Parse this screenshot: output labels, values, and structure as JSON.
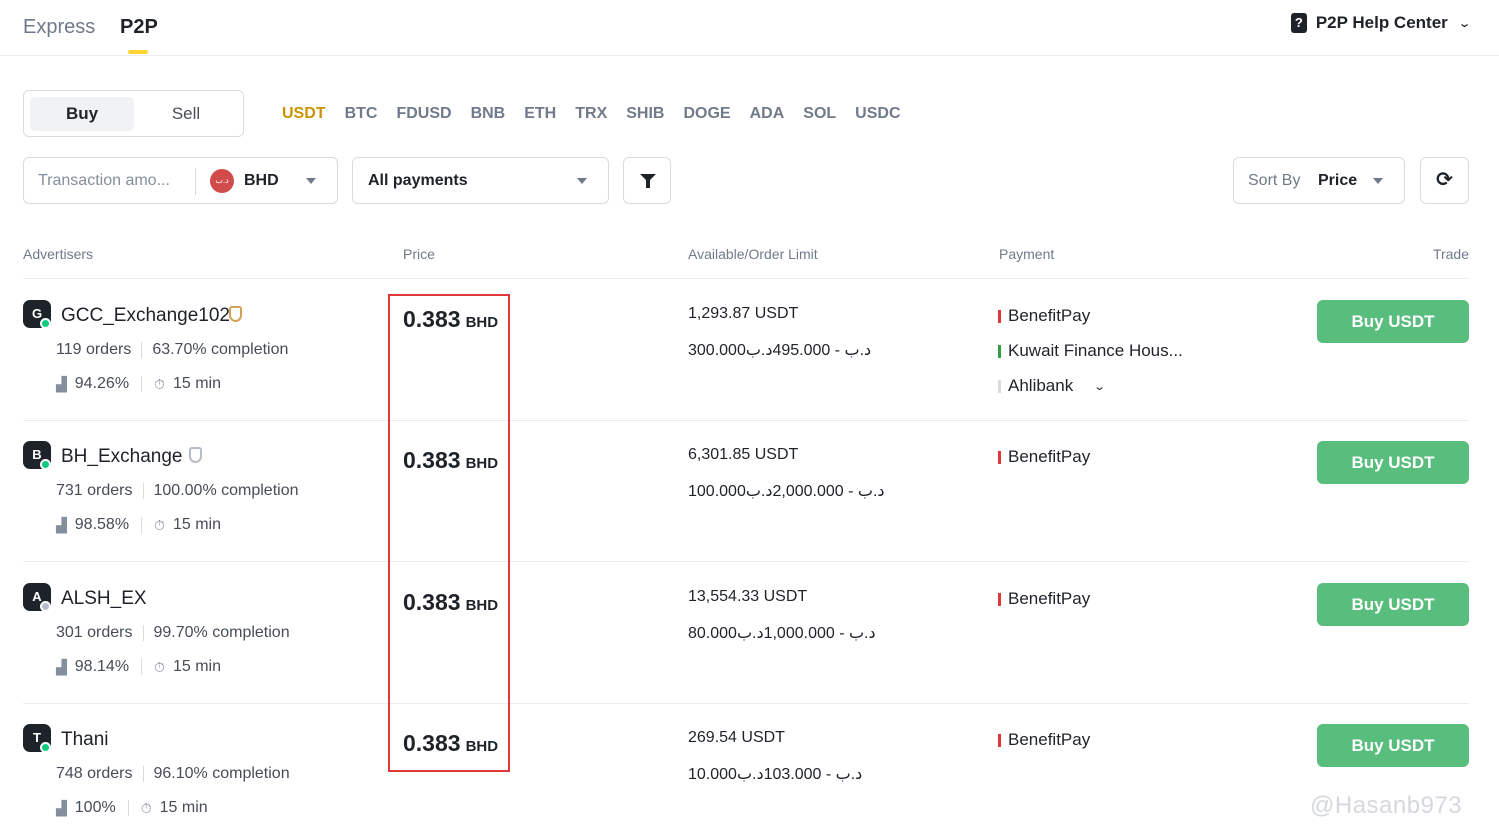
{
  "top_tabs": {
    "express": "Express",
    "p2p": "P2P"
  },
  "help": {
    "icon": "help-doc-icon",
    "label": "P2P Help Center"
  },
  "trade_mode": {
    "buy": "Buy",
    "sell": "Sell"
  },
  "coins": [
    "USDT",
    "BTC",
    "FDUSD",
    "BNB",
    "ETH",
    "TRX",
    "SHIB",
    "DOGE",
    "ADA",
    "SOL",
    "USDC"
  ],
  "filters": {
    "amount_placeholder": "Transaction amo...",
    "currency": "BHD",
    "currency_icon_text": "د.ب",
    "payments": "All payments",
    "sort_by_label": "Sort By",
    "sort_by_value": "Price"
  },
  "table_headers": {
    "advertisers": "Advertisers",
    "price": "Price",
    "available": "Available/Order Limit",
    "payment": "Payment",
    "trade": "Trade"
  },
  "rows": [
    {
      "initial": "G",
      "name": "GCC_Exchange102",
      "badge": "gold",
      "online": true,
      "orders": "119 orders",
      "completion": "63.70% completion",
      "rating": "94.26%",
      "time": "15 min",
      "price": "0.383",
      "unit": "BHD",
      "available": "1,293.87 USDT",
      "limit": "300.000د.ب - 495.000د.ب",
      "payments": [
        {
          "name": "BenefitPay",
          "color": "#e0373a"
        },
        {
          "name": "Kuwait Finance Hous...",
          "color": "#2ea043"
        },
        {
          "name": "Ahlibank",
          "color": "#d9dbdf"
        }
      ],
      "button": "Buy USDT"
    },
    {
      "initial": "B",
      "name": "BH_Exchange",
      "badge": "silver",
      "online": true,
      "orders": "731 orders",
      "completion": "100.00% completion",
      "rating": "98.58%",
      "time": "15 min",
      "price": "0.383",
      "unit": "BHD",
      "available": "6,301.85 USDT",
      "limit": "100.000د.ب - 2,000.000د.ب",
      "payments": [
        {
          "name": "BenefitPay",
          "color": "#e0373a"
        }
      ],
      "button": "Buy USDT"
    },
    {
      "initial": "A",
      "name": "ALSH_EX",
      "badge": "",
      "online": false,
      "orders": "301 orders",
      "completion": "99.70% completion",
      "rating": "98.14%",
      "time": "15 min",
      "price": "0.383",
      "unit": "BHD",
      "available": "13,554.33 USDT",
      "limit": "80.000د.ب - 1,000.000د.ب",
      "payments": [
        {
          "name": "BenefitPay",
          "color": "#e0373a"
        }
      ],
      "button": "Buy USDT"
    },
    {
      "initial": "T",
      "name": "Thani",
      "badge": "",
      "online": true,
      "orders": "748 orders",
      "completion": "96.10% completion",
      "rating": "100%",
      "time": "15 min",
      "price": "0.383",
      "unit": "BHD",
      "available": "269.54 USDT",
      "limit": "10.000د.ب - 103.000د.ب",
      "payments": [
        {
          "name": "BenefitPay",
          "color": "#e0373a"
        }
      ],
      "button": "Buy USDT"
    }
  ],
  "watermark": "@Hasanb973",
  "colors": {
    "accent": "#c99400",
    "buy": "#58bd7d",
    "highlight": "#e0373a"
  }
}
